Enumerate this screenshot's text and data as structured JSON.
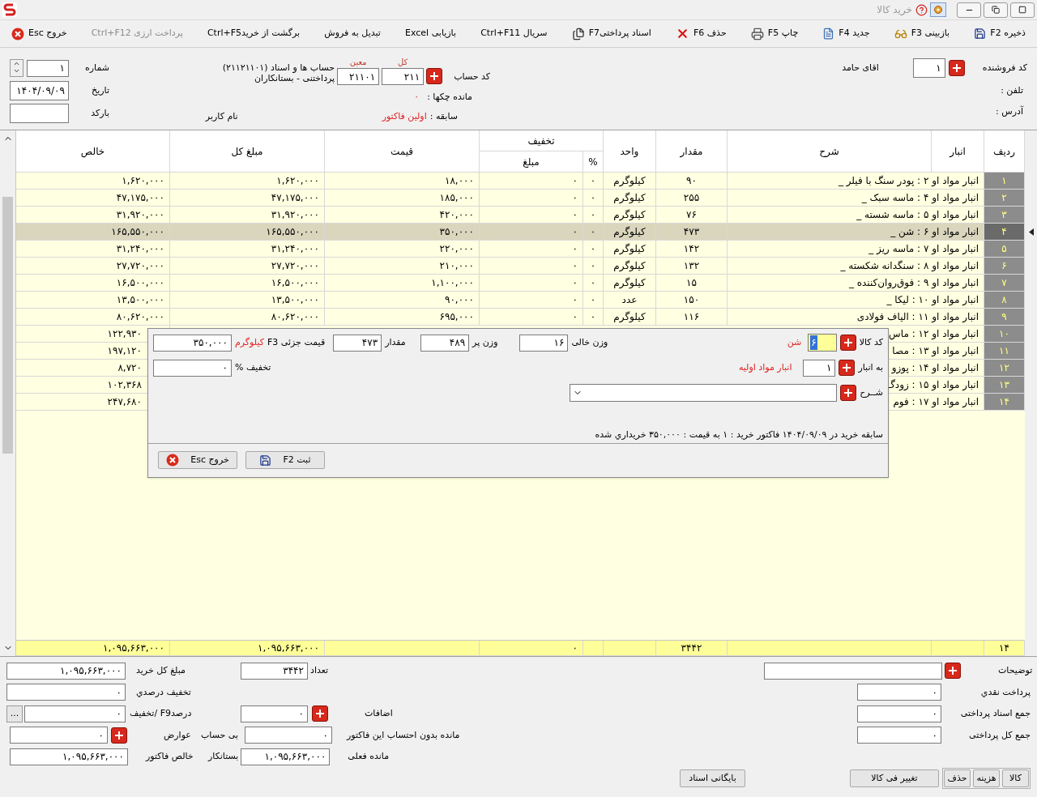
{
  "window": {
    "title": "خرید کالا"
  },
  "toolbar": [
    {
      "label": "ذخیره F2",
      "disabled": false
    },
    {
      "label": "بازبینی F3",
      "disabled": false
    },
    {
      "label": "جدید F4",
      "disabled": false
    },
    {
      "label": "چاپ F5",
      "disabled": false
    },
    {
      "label": "حذف F6",
      "disabled": false
    },
    {
      "label": "اسناد پرداختیF7",
      "disabled": false
    },
    {
      "label": "سریال Ctrl+F11",
      "disabled": false
    },
    {
      "label": "بازیابی Excel",
      "disabled": false
    },
    {
      "label": "تبدیل به فروش",
      "disabled": false
    },
    {
      "label": "برگشت از خریدCtrl+F5",
      "disabled": false
    },
    {
      "label": "پرداخت ارزی Ctrl+F12",
      "disabled": true
    },
    {
      "label": "خروج Esc",
      "disabled": false
    }
  ],
  "header": {
    "supplier_code": {
      "label": "کد فروشنده",
      "value": "۱"
    },
    "supplier_name": "اقای حامد",
    "phone_label": "تلفن :",
    "address_label": "آدرس :",
    "account": {
      "label": "کد حساب",
      "kol_label": "کل",
      "moin_label": "معین",
      "kol": "۲۱۱",
      "moin": "۲۱۱۰۱",
      "name_line1": "حساب ها و اسناد (۲۱۱۲۱۱۰۱)",
      "name_line2": "پرداختنی - بستانکاران"
    },
    "cheque_balance": {
      "label": "مانده چکها :",
      "value": "۰"
    },
    "history": {
      "label": "سابقه :",
      "value": "اولین فاکتور"
    },
    "user_label": "نام کاربر",
    "number": {
      "label": "شماره",
      "value": "۱"
    },
    "date": {
      "label": "تاریخ",
      "value": "۱۴۰۴/۰۹/۰۹"
    },
    "barcode": {
      "label": "بارکد"
    }
  },
  "table": {
    "columns": {
      "num": "ردیف",
      "warehouse": "انبار",
      "description": "شرح",
      "qty": "مقدار",
      "unit": "واحد",
      "discount": "تخفیف",
      "disc_pct": "%",
      "disc_amount": "مبلغ",
      "price": "قیمت",
      "total": "مبلغ کل",
      "net": "خالص"
    },
    "rows": [
      {
        "kind": "full",
        "num": "۱",
        "description": "انبار مواد او ۲ : پودر سنگ با فیلر _",
        "qty": "۹۰",
        "unit": "کیلوگرم",
        "disc_pct": "۰",
        "disc_amount": "۰",
        "price": "۱۸,۰۰۰",
        "total": "۱,۶۲۰,۰۰۰",
        "net": "۱,۶۲۰,۰۰۰",
        "selected": false
      },
      {
        "kind": "full",
        "num": "۲",
        "description": "انبار مواد او ۴ : ماسه سبک _",
        "qty": "۲۵۵",
        "unit": "کیلوگرم",
        "disc_pct": "۰",
        "disc_amount": "۰",
        "price": "۱۸۵,۰۰۰",
        "total": "۴۷,۱۷۵,۰۰۰",
        "net": "۴۷,۱۷۵,۰۰۰",
        "selected": false
      },
      {
        "kind": "full",
        "num": "۳",
        "description": "انبار مواد او ۵ : ماسه شسته _",
        "qty": "۷۶",
        "unit": "کیلوگرم",
        "disc_pct": "۰",
        "disc_amount": "۰",
        "price": "۴۲۰,۰۰۰",
        "total": "۳۱,۹۲۰,۰۰۰",
        "net": "۳۱,۹۲۰,۰۰۰",
        "selected": false
      },
      {
        "kind": "full",
        "num": "۴",
        "description": "انبار مواد او ۶ : شن _",
        "qty": "۴۷۳",
        "unit": "کیلوگرم",
        "disc_pct": "۰",
        "disc_amount": "۰",
        "price": "۳۵۰,۰۰۰",
        "total": "۱۶۵,۵۵۰,۰۰۰",
        "net": "۱۶۵,۵۵۰,۰۰۰",
        "selected": true
      },
      {
        "kind": "full",
        "num": "۵",
        "description": "انبار مواد او ۷ : ماسه ریز _",
        "qty": "۱۴۲",
        "unit": "کیلوگرم",
        "disc_pct": "۰",
        "disc_amount": "۰",
        "price": "۲۲۰,۰۰۰",
        "total": "۳۱,۲۴۰,۰۰۰",
        "net": "۳۱,۲۴۰,۰۰۰",
        "selected": false
      },
      {
        "kind": "full",
        "num": "۶",
        "description": "انبار مواد او ۸ : سنگدانه شکسته _",
        "qty": "۱۳۲",
        "unit": "کیلوگرم",
        "disc_pct": "۰",
        "disc_amount": "۰",
        "price": "۲۱۰,۰۰۰",
        "total": "۲۷,۷۲۰,۰۰۰",
        "net": "۲۷,۷۲۰,۰۰۰",
        "selected": false
      },
      {
        "kind": "full",
        "num": "۷",
        "description": "انبار مواد او ۹ : فوق‌روان‌کننده _",
        "qty": "۱۵",
        "unit": "کیلوگرم",
        "disc_pct": "۰",
        "disc_amount": "۰",
        "price": "۱,۱۰۰,۰۰۰",
        "total": "۱۶,۵۰۰,۰۰۰",
        "net": "۱۶,۵۰۰,۰۰۰",
        "selected": false
      },
      {
        "kind": "full",
        "num": "۸",
        "description": "انبار مواد او ۱۰ : لیکا _",
        "qty": "۱۵۰",
        "unit": "عدد",
        "disc_pct": "۰",
        "disc_amount": "۰",
        "price": "۹۰,۰۰۰",
        "total": "۱۳,۵۰۰,۰۰۰",
        "net": "۱۳,۵۰۰,۰۰۰",
        "selected": false
      },
      {
        "kind": "full",
        "num": "۹",
        "description": "انبار مواد او ۱۱ : الیاف فولادی",
        "qty": "۱۱۶",
        "unit": "کیلوگرم",
        "disc_pct": "۰",
        "disc_amount": "۰",
        "price": "۶۹۵,۰۰۰",
        "total": "۸۰,۶۲۰,۰۰۰",
        "net": "۸۰,۶۲۰,۰۰۰",
        "selected": false
      },
      {
        "kind": "covered",
        "num": "۱۰",
        "description": "انبار مواد او ۱۲ : ماس",
        "net": "۱۲۲,۹۳۰",
        "selected": false
      },
      {
        "kind": "covered",
        "num": "۱۱",
        "description": "انبار مواد او ۱۳ : مصا",
        "net": "۱۹۷,۱۲۰",
        "selected": false
      },
      {
        "kind": "covered",
        "num": "۱۲",
        "description": "انبار مواد او ۱۴ : پوزو",
        "net": "۸,۷۲۰",
        "selected": false
      },
      {
        "kind": "covered",
        "num": "۱۳",
        "description": "انبار مواد او ۱۵ : زودگ",
        "net": "۱۰۲,۳۶۸",
        "selected": false
      },
      {
        "kind": "covered",
        "num": "۱۴",
        "description": "انبار مواد او ۱۷ : فوم",
        "net": "۲۴۷,۶۸۰",
        "selected": false
      }
    ],
    "totals": {
      "num": "۱۴",
      "qty": "۳۴۴۲",
      "disc_amount": "۰",
      "total": "۱,۰۹۵,۶۶۳,۰۰۰",
      "net": "۱,۰۹۵,۶۶۳,۰۰۰"
    }
  },
  "dialog": {
    "item_code": {
      "label": "کد کالا",
      "value": "۶",
      "name": "شن"
    },
    "warehouse": {
      "label": "به انبار",
      "value": "۱",
      "name": "انبار مواد اولیه"
    },
    "description": {
      "label": "شــرح"
    },
    "empty_weight": {
      "label": "وزن خالی",
      "value": "۱۶"
    },
    "full_weight": {
      "label": "وزن پر",
      "value": "۴۸۹"
    },
    "quantity": {
      "label": "مقدار",
      "value": "۴۷۳",
      "unit": "کیلوگرم"
    },
    "unit_price": {
      "label": "قیمت جزئی F3",
      "value": "۳۵۰,۰۰۰"
    },
    "discount": {
      "label": "تخفیف %",
      "value": "۰"
    },
    "history": "سابقه خرید در ۱۴۰۴/۰۹/۰۹ فاکتور خرید : ۱ به قیمت : ۳۵۰,۰۰۰ خریداري شده",
    "buttons": [
      {
        "label": "ثبت F2"
      },
      {
        "label": "خروج Esc"
      }
    ]
  },
  "summary": {
    "count": {
      "label": "تعداد",
      "value": "۳۴۴۲"
    },
    "purchase_total": {
      "label": "مبلغ کل خرید",
      "value": "۱,۰۹۵,۶۶۳,۰۰۰"
    },
    "percent_discount": {
      "label": "تخفیف درصدي",
      "value": "۰"
    },
    "f9_discount": {
      "label": "تخفیف/ F9درصد",
      "value": "۰",
      "more": "..."
    },
    "tolls": {
      "label": "عوارض",
      "value": "۰"
    },
    "invoice_net": {
      "label": "خالص فاکتور",
      "value": "۱,۰۹۵,۶۶۳,۰۰۰"
    },
    "additions": {
      "label": "اضافات",
      "value": "۰"
    },
    "balance_excl": {
      "label": "مانده بدون احتساب این فاکتور",
      "status": "بی حساب",
      "value": "۰"
    },
    "current_balance": {
      "label": "مانده فعلی",
      "status": "بستانکار",
      "value": "۱,۰۹۵,۶۶۳,۰۰۰"
    },
    "notes": {
      "label": "توضیحات"
    },
    "cash": {
      "label": "پرداخت نقدي",
      "value": "۰"
    },
    "docs_total": {
      "label": "جمع اسناد پرداختی",
      "value": "۰"
    },
    "paid_total": {
      "label": "جمع کل پرداختی",
      "value": "۰"
    }
  },
  "bottom_buttons": [
    {
      "label": "کالا"
    },
    {
      "label": "هزینه"
    },
    {
      "label": "حذف"
    },
    {
      "label": "تغییر فی کالا"
    },
    {
      "label": "بایگانی اسناد"
    }
  ]
}
